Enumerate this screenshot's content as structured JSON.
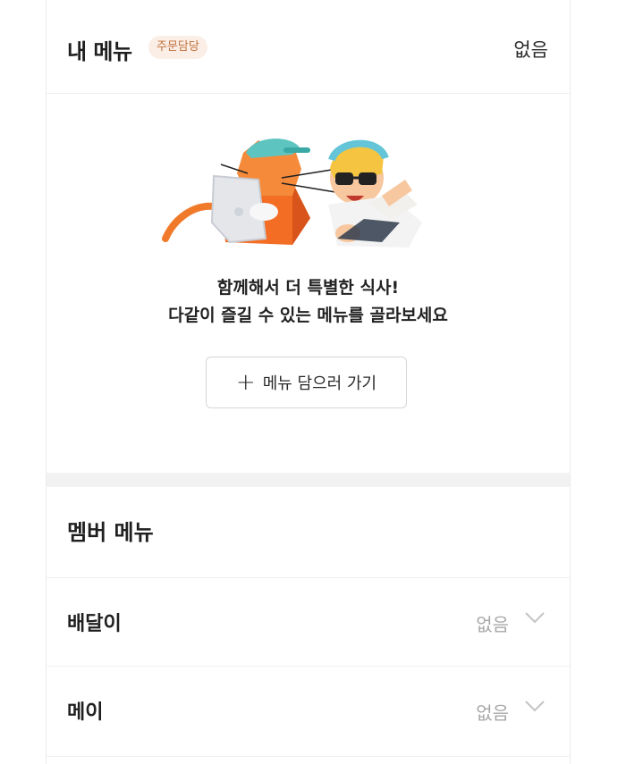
{
  "header": {
    "title": "내 메뉴",
    "badge": "주문담당",
    "status": "없음"
  },
  "empty_state": {
    "line1": "함께해서 더 특별한 식사!",
    "line2": "다같이 즐길 수 있는 메뉴를 골라보세요",
    "button_label": "메뉴 담으러 가기",
    "button_icon": "plus-icon"
  },
  "members": {
    "title": "멤버 메뉴",
    "items": [
      {
        "name": "배달이",
        "status": "없음"
      },
      {
        "name": "메이",
        "status": "없음"
      }
    ]
  },
  "colors": {
    "badge_bg": "#fbeee6",
    "badge_text": "#c0713c",
    "muted": "#a8a8a8",
    "band": "#f2f2f2"
  }
}
